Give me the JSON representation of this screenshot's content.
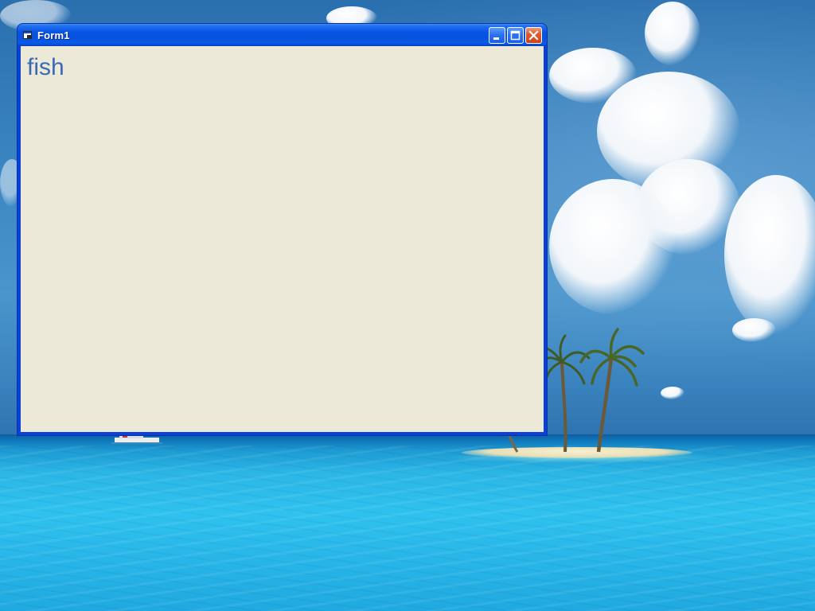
{
  "window": {
    "title": "Form1",
    "label_text": "fish",
    "icon": "form-icon",
    "buttons": [
      "minimize-icon",
      "maximize-icon",
      "close-icon"
    ]
  },
  "colors": {
    "titlebar": "#0a55e4",
    "client_background": "#ece9d8",
    "label_text": "#3a69b7",
    "close_button": "#e0592f"
  }
}
